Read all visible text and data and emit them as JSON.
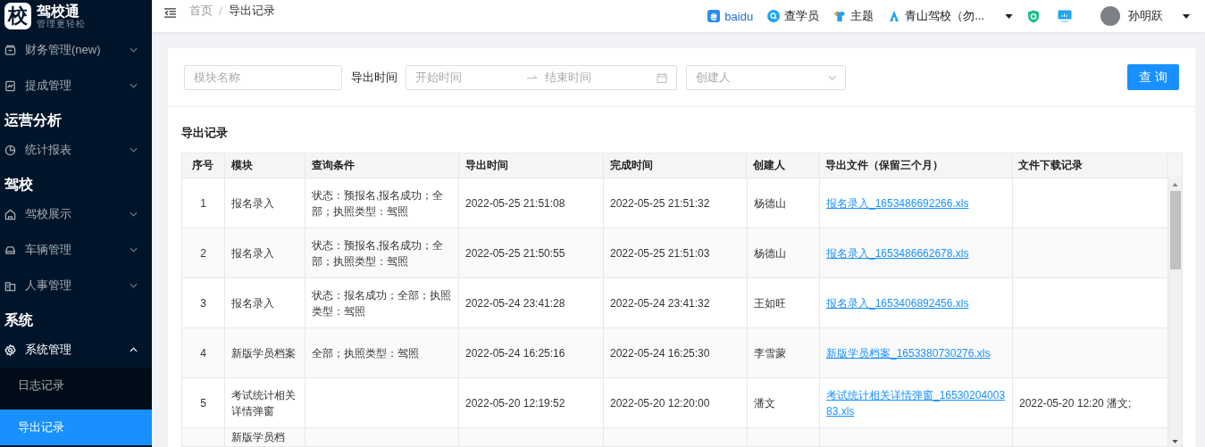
{
  "logo": {
    "mark": "校",
    "name": "驾校通",
    "slogan": "管理更轻松"
  },
  "sidebar": {
    "items": [
      {
        "kind": "item",
        "label": "财务管理(new)",
        "expanded": false
      },
      {
        "kind": "item",
        "label": "提成管理",
        "expanded": false
      },
      {
        "kind": "heading",
        "label": "运营分析"
      },
      {
        "kind": "item",
        "label": "统计报表",
        "expanded": false
      },
      {
        "kind": "heading",
        "label": "驾校"
      },
      {
        "kind": "item",
        "label": "驾校展示",
        "expanded": false
      },
      {
        "kind": "item",
        "label": "车辆管理",
        "expanded": false
      },
      {
        "kind": "item",
        "label": "人事管理",
        "expanded": false
      },
      {
        "kind": "heading",
        "label": "系统"
      },
      {
        "kind": "item",
        "label": "系统管理",
        "expanded": true,
        "children": [
          {
            "label": "日志记录",
            "selected": false
          },
          {
            "label": "导出记录",
            "selected": true
          }
        ]
      }
    ]
  },
  "breadcrumb": {
    "items": [
      "首页",
      "导出记录"
    ],
    "separator": "/"
  },
  "header": {
    "links": [
      "baidu",
      "查学员",
      "主题"
    ],
    "school": "青山驾校（勿...",
    "user": "孙明跃"
  },
  "filters": {
    "module_placeholder": "模块名称",
    "time_label": "导出时间",
    "start_placeholder": "开始时间",
    "end_placeholder": "结束时间",
    "creator_placeholder": "创建人",
    "query_button": "查 询"
  },
  "section_title": "导出记录",
  "table": {
    "columns": [
      "序号",
      "模块",
      "查询条件",
      "导出时间",
      "完成时间",
      "创建人",
      "导出文件（保留三个月）",
      "文件下载记录"
    ],
    "rows": [
      {
        "index": "1",
        "module": "报名录入",
        "conditions": "状态：预报名,报名成功；全部；执照类型：驾照",
        "export_time": "2022-05-25 21:51:08",
        "finish_time": "2022-05-25 21:51:32",
        "creator": "杨德山",
        "file": "报名录入_1653486692266.xls",
        "download_record": ""
      },
      {
        "index": "2",
        "module": "报名录入",
        "conditions": "状态：预报名,报名成功；全部；执照类型：驾照",
        "export_time": "2022-05-25 21:50:55",
        "finish_time": "2022-05-25 21:51:03",
        "creator": "杨德山",
        "file": "报名录入_1653486662678.xls",
        "download_record": ""
      },
      {
        "index": "3",
        "module": "报名录入",
        "conditions": "状态：报名成功；全部；执照类型：驾照",
        "export_time": "2022-05-24 23:41:28",
        "finish_time": "2022-05-24 23:41:32",
        "creator": "王如旺",
        "file": "报名录入_1653406892456.xls",
        "download_record": ""
      },
      {
        "index": "4",
        "module": "新版学员档案",
        "conditions": "全部；执照类型：驾照",
        "export_time": "2022-05-24 16:25:16",
        "finish_time": "2022-05-24 16:25:30",
        "creator": "李雪蒙",
        "file": "新版学员档案_1653380730276.xls",
        "download_record": ""
      },
      {
        "index": "5",
        "module": "考试统计相关详情弹窗",
        "conditions": "",
        "export_time": "2022-05-20 12:19:52",
        "finish_time": "2022-05-20 12:20:00",
        "creator": "潘文",
        "file": "考试统计相关详情弹窗_1653020400383.xls",
        "download_record": "2022-05-20 12:20 潘文;"
      },
      {
        "index": "",
        "module": "新版学员档",
        "conditions": "",
        "export_time": "",
        "finish_time": "",
        "creator": "",
        "file": "",
        "download_record": ""
      }
    ]
  }
}
